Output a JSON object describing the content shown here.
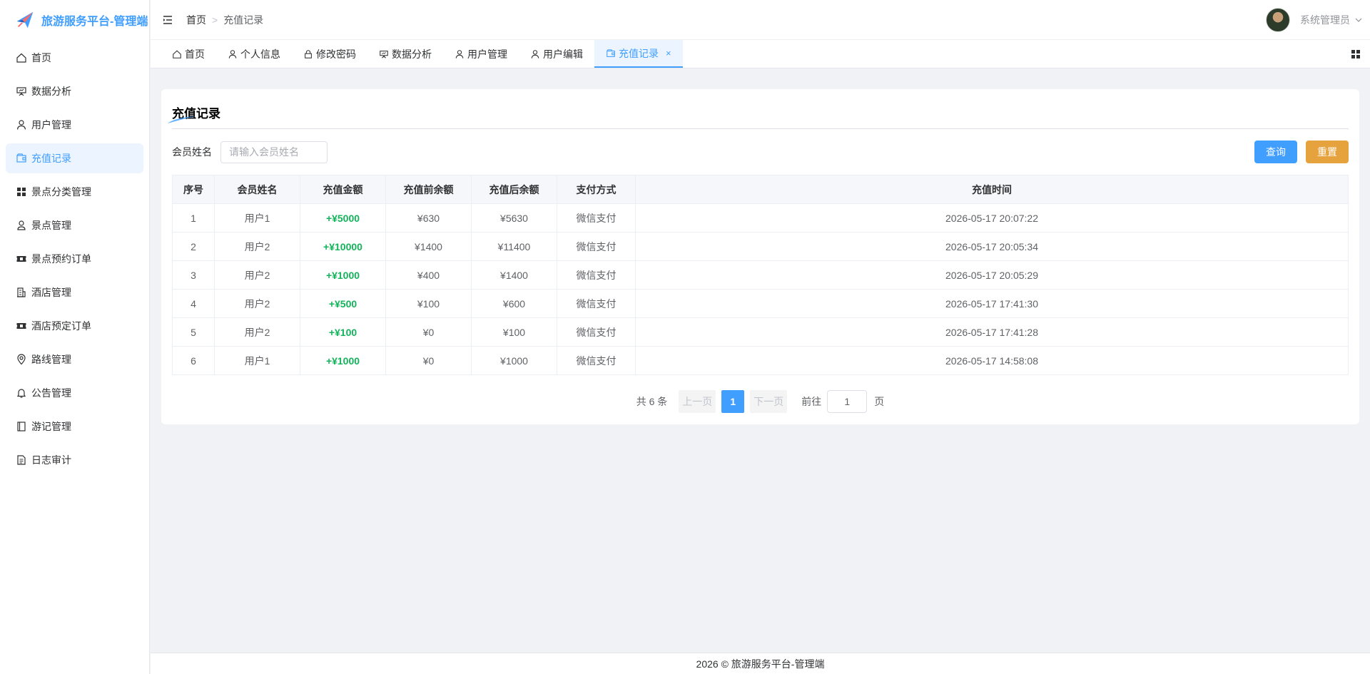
{
  "app": {
    "title": "旅游服务平台-管理端",
    "logo_icon": "airplane-icon"
  },
  "sidebar": {
    "items": [
      {
        "label": "首页",
        "icon": "home-icon"
      },
      {
        "label": "数据分析",
        "icon": "presentation-icon"
      },
      {
        "label": "用户管理",
        "icon": "user-icon"
      },
      {
        "label": "充值记录",
        "icon": "wallet-icon",
        "active": true
      },
      {
        "label": "景点分类管理",
        "icon": "grid-icon"
      },
      {
        "label": "景点管理",
        "icon": "person-pin-icon"
      },
      {
        "label": "景点预约订单",
        "icon": "ticket-icon"
      },
      {
        "label": "酒店管理",
        "icon": "building-icon"
      },
      {
        "label": "酒店预定订单",
        "icon": "ticket-icon"
      },
      {
        "label": "路线管理",
        "icon": "location-icon"
      },
      {
        "label": "公告管理",
        "icon": "bell-icon"
      },
      {
        "label": "游记管理",
        "icon": "notebook-icon"
      },
      {
        "label": "日志审计",
        "icon": "document-icon"
      }
    ]
  },
  "header": {
    "breadcrumb": {
      "home": "首页",
      "current": "充值记录"
    },
    "user": {
      "name": "系统管理员"
    }
  },
  "tabs": [
    {
      "label": "首页",
      "icon": "home-icon"
    },
    {
      "label": "个人信息",
      "icon": "user-icon"
    },
    {
      "label": "修改密码",
      "icon": "lock-icon"
    },
    {
      "label": "数据分析",
      "icon": "presentation-icon"
    },
    {
      "label": "用户管理",
      "icon": "user-icon"
    },
    {
      "label": "用户编辑",
      "icon": "user-icon"
    },
    {
      "label": "充值记录",
      "icon": "wallet-icon",
      "active": true,
      "close": "×"
    }
  ],
  "main": {
    "title": "充值记录",
    "search": {
      "label": "会员姓名",
      "placeholder": "请输入会员姓名",
      "value": ""
    },
    "buttons": {
      "query": "查询",
      "reset": "重置"
    },
    "table": {
      "columns": [
        "序号",
        "会员姓名",
        "充值金额",
        "充值前余额",
        "充值后余额",
        "支付方式",
        "充值时间"
      ],
      "rows": [
        [
          "1",
          "用户1",
          "+¥5000",
          "¥630",
          "¥5630",
          "微信支付",
          "2026-05-17 20:07:22"
        ],
        [
          "2",
          "用户2",
          "+¥10000",
          "¥1400",
          "¥11400",
          "微信支付",
          "2026-05-17 20:05:34"
        ],
        [
          "3",
          "用户2",
          "+¥1000",
          "¥400",
          "¥1400",
          "微信支付",
          "2026-05-17 20:05:29"
        ],
        [
          "4",
          "用户2",
          "+¥500",
          "¥100",
          "¥600",
          "微信支付",
          "2026-05-17 17:41:30"
        ],
        [
          "5",
          "用户2",
          "+¥100",
          "¥0",
          "¥100",
          "微信支付",
          "2026-05-17 17:41:28"
        ],
        [
          "6",
          "用户1",
          "+¥1000",
          "¥0",
          "¥1000",
          "微信支付",
          "2026-05-17 14:58:08"
        ]
      ]
    },
    "pagination": {
      "total": "共 6 条",
      "prev": "上一页",
      "current": "1",
      "next": "下一页",
      "goto_prefix": "前往",
      "goto_value": "1",
      "goto_suffix": "页"
    }
  },
  "footer": {
    "text": "2026 © 旅游服务平台-管理端"
  },
  "colors": {
    "primary": "#409eff",
    "warning": "#e6a23c",
    "success_amount": "#13b35a"
  }
}
